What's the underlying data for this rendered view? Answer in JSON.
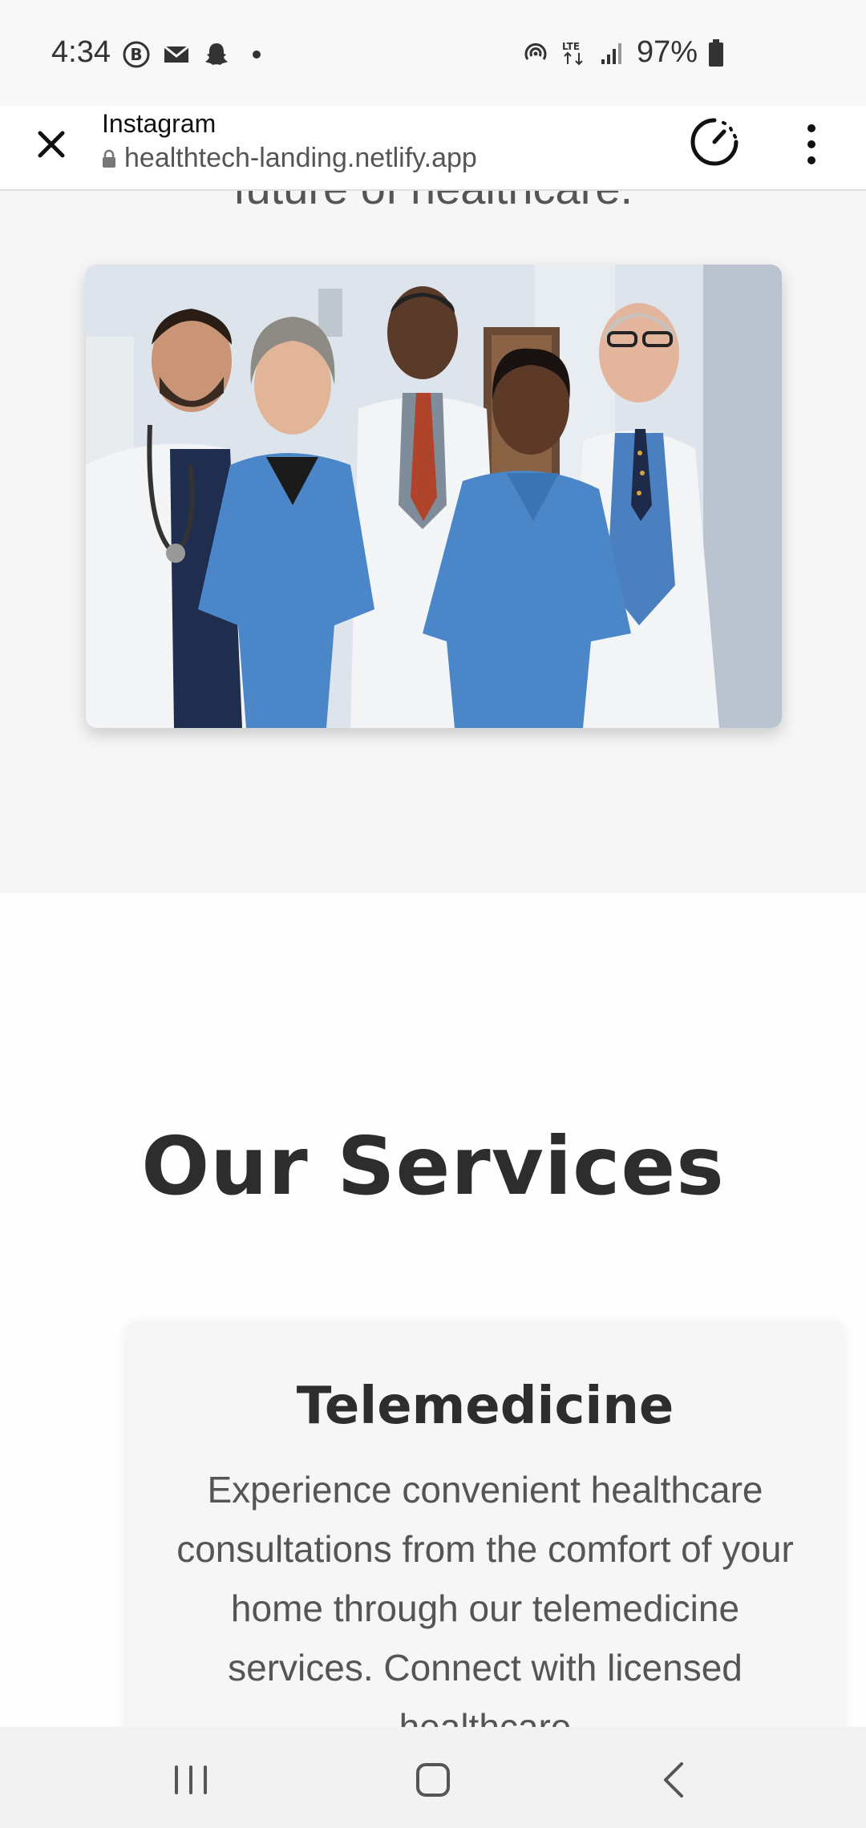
{
  "status_bar": {
    "time": "4:34",
    "battery": "97%",
    "network": "LTE"
  },
  "browser": {
    "title": "Instagram",
    "url": "healthtech-landing.netlify.app"
  },
  "hero": {
    "tagline": "future of healthcare.",
    "image_alt": "Team of doctors and nurses"
  },
  "services": {
    "heading": "Our Services",
    "cards": [
      {
        "title": "Telemedicine",
        "text": "Experience convenient healthcare consultations from the comfort of your home through our telemedicine services. Connect with licensed healthcare"
      }
    ]
  },
  "colors": {
    "hero_bg": "#f6f6f6",
    "heading": "#2d2d2d",
    "body_text": "#555555",
    "scrub_blue": "#4a86c8",
    "coat_white": "#f2f4f6"
  }
}
